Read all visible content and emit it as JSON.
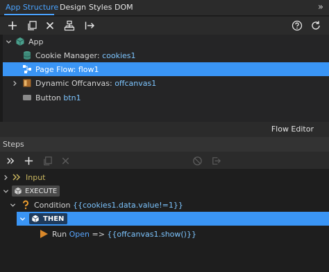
{
  "tabs": [
    "App Structure",
    "Design",
    "Styles",
    "DOM"
  ],
  "tabs_collapse": "»",
  "tree": {
    "root_label": "App",
    "items": [
      {
        "label": "Cookie Manager:",
        "id": "cookies1"
      },
      {
        "label": "Page Flow:",
        "id": "flow1",
        "selected": true
      },
      {
        "label": "Dynamic Offcanvas:",
        "id": "offcanvas1"
      },
      {
        "label": "Button",
        "id": "btn1"
      }
    ]
  },
  "flow_editor_label": "Flow Editor",
  "steps": {
    "title": "Steps",
    "input_label": "Input",
    "execute_label": "EXECUTE",
    "condition_label": "Condition",
    "condition_expr": "{{cookies1.data.value!=1}}",
    "then_label": "THEN",
    "run_label": "Run",
    "run_action": "Open",
    "run_arrow": "=>",
    "run_expr": "{{offcanvas1.show()}}"
  },
  "colors": {
    "accent": "#3a95f5",
    "tab_active": "#4aa3ff",
    "id_text": "#7dc5ff",
    "condition_icon": "#f0a030",
    "input_label": "#c8b560"
  },
  "icons": {
    "toolbar": [
      "plus-icon",
      "copy-icon",
      "close-icon",
      "component-tree-icon",
      "export-arrow-icon",
      "help-icon",
      "refresh-icon"
    ],
    "steps_toolbar": [
      "expand-all-icon",
      "plus-icon",
      "copy-icon",
      "close-icon",
      "disable-icon",
      "export-icon"
    ]
  }
}
